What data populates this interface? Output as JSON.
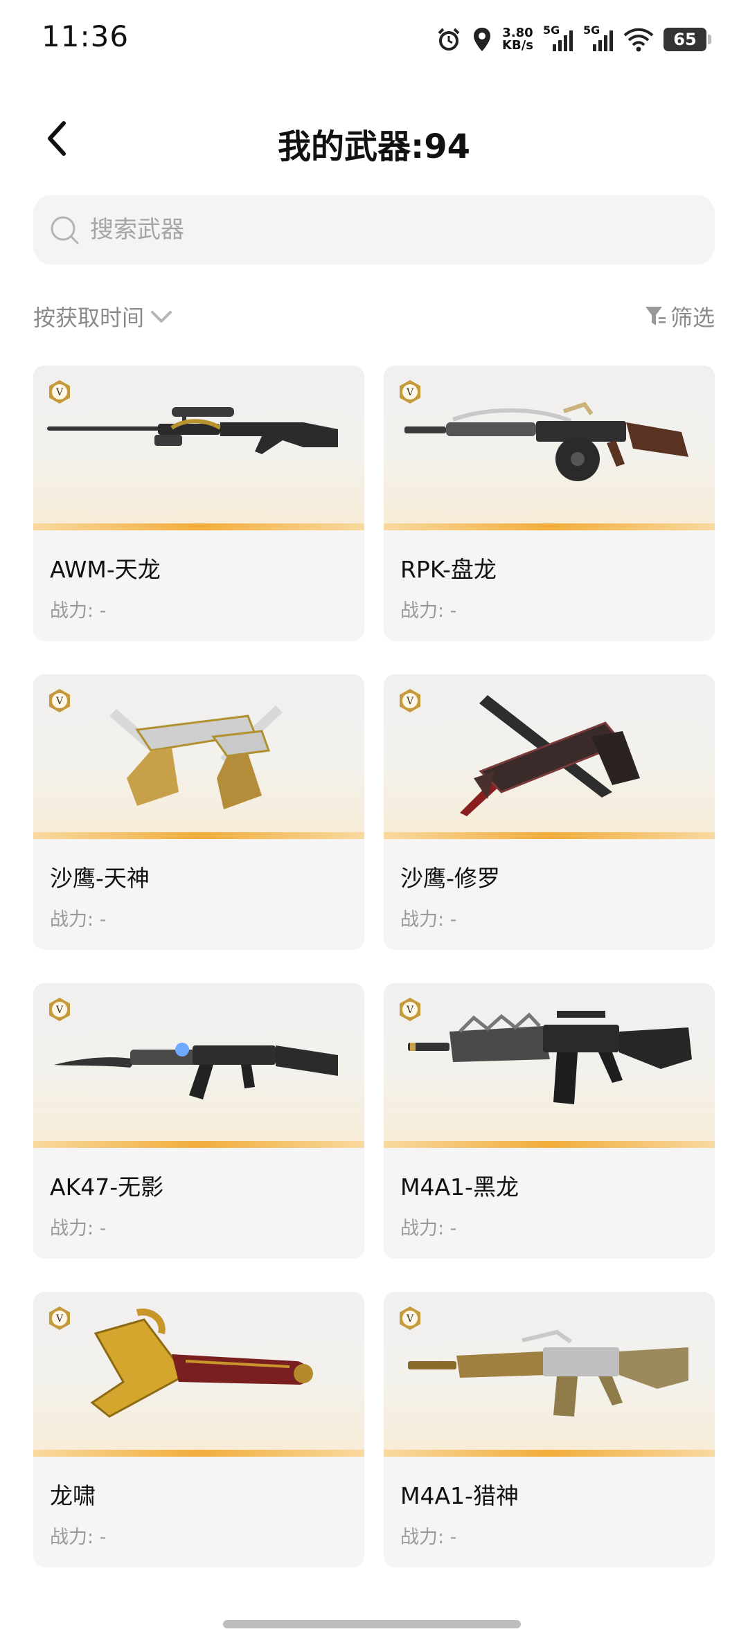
{
  "status_bar": {
    "time": "11:36",
    "net_speed_value": "3.80",
    "net_speed_unit": "KB/s",
    "signal_1_label": "5G",
    "signal_2_label": "5G",
    "battery": "65"
  },
  "header": {
    "title": "我的武器:94"
  },
  "search": {
    "placeholder": "搜索武器"
  },
  "toolbar": {
    "sort_label": "按获取时间",
    "filter_label": "筛选"
  },
  "weapons": [
    {
      "name": "AWM-天龙",
      "power": "战力: -",
      "icon": "sniper-rifle-icon"
    },
    {
      "name": "RPK-盘龙",
      "power": "战力: -",
      "icon": "machine-gun-icon"
    },
    {
      "name": "沙鹰-天神",
      "power": "战力: -",
      "icon": "dual-pistol-icon"
    },
    {
      "name": "沙鹰-修罗",
      "power": "战力: -",
      "icon": "pistol-blade-icon"
    },
    {
      "name": "AK47-无影",
      "power": "战力: -",
      "icon": "assault-rifle-icon"
    },
    {
      "name": "M4A1-黑龙",
      "power": "战力: -",
      "icon": "assault-rifle-icon"
    },
    {
      "name": "龙啸",
      "power": "战力: -",
      "icon": "dragon-axe-icon"
    },
    {
      "name": "M4A1-猎神",
      "power": "战力: -",
      "icon": "assault-rifle-icon"
    }
  ],
  "badge_letter": "V",
  "colors": {
    "accent_gold": "#f2ad3b",
    "card_background": "#f5f5f5",
    "secondary_text": "#9a9a9a"
  }
}
